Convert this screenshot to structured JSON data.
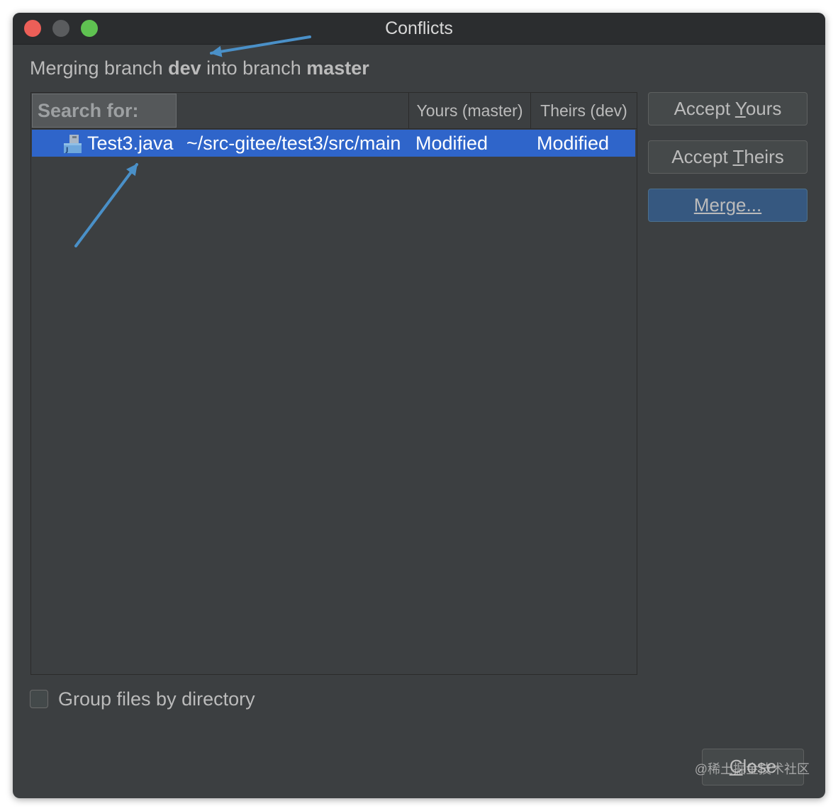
{
  "window": {
    "title": "Conflicts"
  },
  "merge_info": {
    "prefix": "Merging branch ",
    "source_branch": "dev",
    "middle": " into branch ",
    "target_branch": "master"
  },
  "table": {
    "search_label": "Search for:",
    "columns": [
      "",
      "Yours (master)",
      "Theirs (dev)"
    ],
    "rows": [
      {
        "name": "Test3.java",
        "path": "~/src-gitee/test3/src/main",
        "yours": "Modified",
        "theirs": "Modified",
        "icon": "java-file-icon"
      }
    ]
  },
  "buttons": {
    "accept_yours_pre": "Accept ",
    "accept_yours_u": "Y",
    "accept_yours_post": "ours",
    "accept_theirs_pre": "Accept ",
    "accept_theirs_u": "T",
    "accept_theirs_post": "heirs",
    "merge_u": "M",
    "merge_post": "erge...",
    "close_u": "C",
    "close_post": "lose"
  },
  "options": {
    "group_by_directory_label": "Group files by directory",
    "group_by_directory_checked": false
  },
  "watermark": "@稀土掘金技术社区",
  "colors": {
    "background": "#3c3f41",
    "selection": "#2f65ca",
    "default_button": "#365880",
    "annotation_arrow": "#4a90c8"
  }
}
